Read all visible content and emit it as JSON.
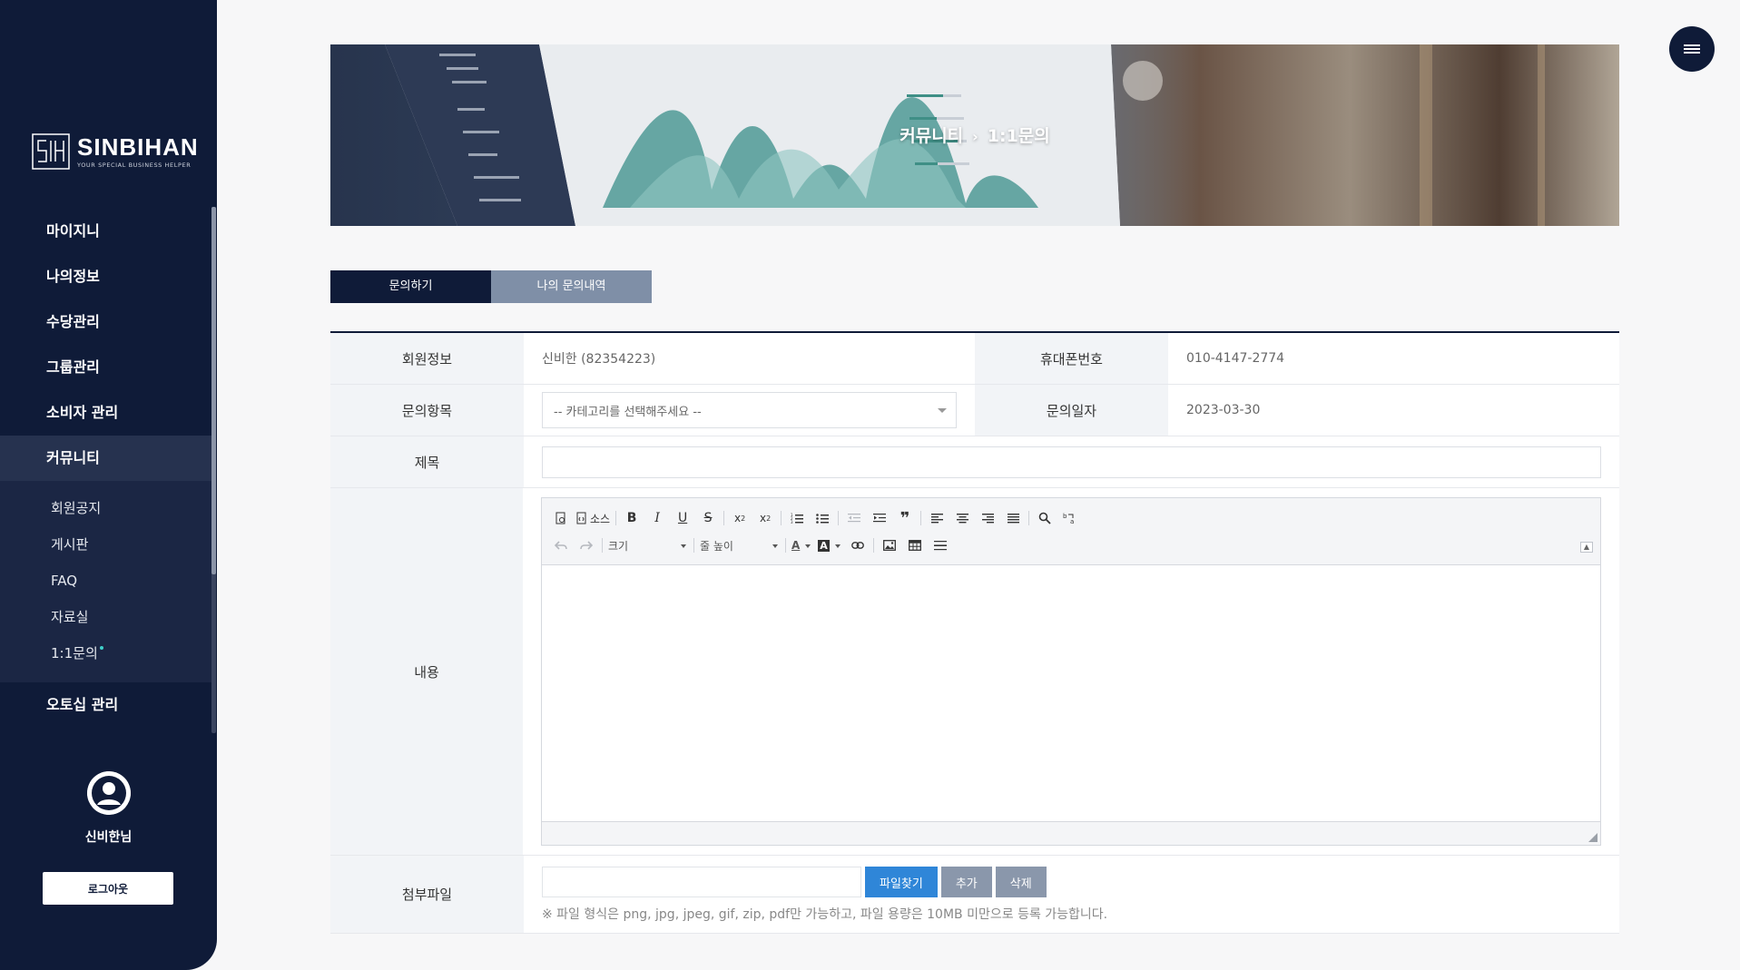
{
  "brand": {
    "title": "SINBIHAN",
    "tagline": "YOUR SPECIAL BUSINESS HELPER"
  },
  "sidebar": {
    "menu": [
      {
        "label": "마이지니"
      },
      {
        "label": "나의정보"
      },
      {
        "label": "수당관리"
      },
      {
        "label": "그룹관리"
      },
      {
        "label": "소비자 관리"
      },
      {
        "label": "커뮤니티"
      }
    ],
    "submenu": [
      {
        "label": "회원공지"
      },
      {
        "label": "게시판"
      },
      {
        "label": "FAQ"
      },
      {
        "label": "자료실"
      },
      {
        "label": "1:1문의"
      }
    ],
    "after_menu": [
      {
        "label": "오토십 관리"
      }
    ],
    "user_name": "신비한님",
    "logout_label": "로그아웃"
  },
  "banner": {
    "crumb_parent": "커뮤니티",
    "crumb_sep": "›",
    "crumb_current": "1:1문의"
  },
  "tabs": [
    {
      "label": "문의하기",
      "active": true
    },
    {
      "label": "나의 문의내역",
      "active": false
    }
  ],
  "form": {
    "member_label": "회원정보",
    "member_value": "신비한 (82354223)",
    "phone_label": "휴대폰번호",
    "phone_value": "010-4147-2774",
    "category_label": "문의항목",
    "category_placeholder": "-- 카테고리를 선택해주세요 --",
    "date_label": "문의일자",
    "date_value": "2023-03-30",
    "title_label": "제목",
    "title_value": "",
    "content_label": "내용",
    "attach_label": "첨부파일",
    "browse_label": "파일찾기",
    "add_label": "추가",
    "delete_label": "삭제",
    "file_note": "※ 파일 형식은 png, jpg, jpeg, gif, zip, pdf만 가능하고, 파일 용량은 10MB 미만으로 등록 가능합니다."
  },
  "editor": {
    "source_label": "소스",
    "size_label": "크기",
    "line_height_label": "줄 높이",
    "font_color_glyph": "A",
    "bg_color_glyph": "A"
  },
  "colors": {
    "navy": "#0f1b38",
    "tab_inactive": "#7f8fa7",
    "primary_button": "#2f86d8",
    "gray_button": "#8a97ab"
  }
}
